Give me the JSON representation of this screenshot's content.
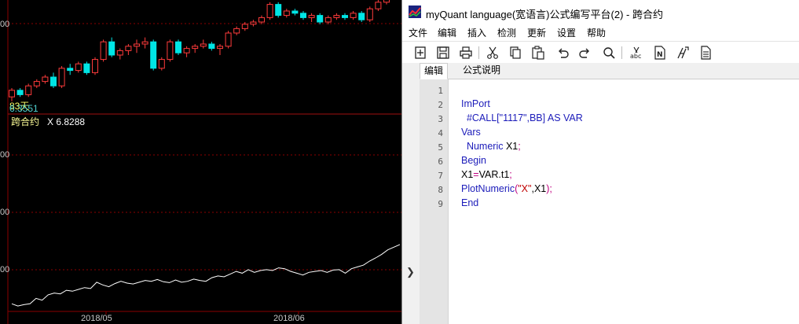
{
  "chart_pane": {
    "main_series_label": "83天",
    "main_series_value": "6.3551",
    "indicator_title": "跨合约",
    "indicator_value_label": "X 6.8288",
    "y_labels": [
      "00",
      "00",
      "00",
      "00"
    ],
    "date_labels": [
      "2018/05",
      "2018/06"
    ],
    "colors": {
      "up": "#ff3b3b",
      "down": "#00e5e5",
      "grid": "#8b0000",
      "line": "#ffffff"
    }
  },
  "editor": {
    "title": "myQuant language(宽语言)公式编写平台(2) - 跨合约",
    "menu": [
      "文件",
      "编辑",
      "插入",
      "检测",
      "更新",
      "设置",
      "帮助"
    ],
    "toolbar_icons": [
      "new-icon",
      "save-icon",
      "print-icon",
      "cut-icon",
      "copy-icon",
      "paste-icon",
      "undo-icon",
      "redo-icon",
      "find-icon",
      "spellcheck-icon",
      "document-n-icon",
      "tools-icon",
      "notes-icon"
    ],
    "tabs": [
      "编辑",
      "公式说明"
    ],
    "line_numbers": [
      "1",
      "2",
      "3",
      "4",
      "5",
      "6",
      "7",
      "8",
      "9"
    ],
    "code": {
      "l2": "ImPort",
      "l3": "  #CALL[\"1117\",BB] AS VAR",
      "l4": "Vars",
      "l5_kw": "  Numeric ",
      "l5_rest": "X1",
      "l5_p": ";",
      "l6": "Begin",
      "l7_a": "X1",
      "l7_eq": "=",
      "l7_b": "VAR.t1",
      "l7_p": ";",
      "l8_kw": "PlotNumeric",
      "l8_p1": "(",
      "l8_str": "\"X\"",
      "l8_c": ",X1",
      "l8_p2": ");",
      "l9": "End"
    }
  },
  "chart_data": [
    {
      "type": "candlestick",
      "title": "",
      "x_labels": [
        "2018/05",
        "2018/06"
      ],
      "candles": [
        [
          5.6,
          5.8,
          5.5,
          5.75
        ],
        [
          5.75,
          5.8,
          5.6,
          5.65
        ],
        [
          5.65,
          5.9,
          5.6,
          5.85
        ],
        [
          5.85,
          6.0,
          5.8,
          5.95
        ],
        [
          5.95,
          6.1,
          5.9,
          6.05
        ],
        [
          6.05,
          6.15,
          5.8,
          5.85
        ],
        [
          5.85,
          6.3,
          5.8,
          6.25
        ],
        [
          6.25,
          6.35,
          6.1,
          6.2
        ],
        [
          6.2,
          6.4,
          6.15,
          6.35
        ],
        [
          6.35,
          6.4,
          6.1,
          6.15
        ],
        [
          6.15,
          6.5,
          6.1,
          6.45
        ],
        [
          6.45,
          6.9,
          6.4,
          6.85
        ],
        [
          6.85,
          6.95,
          6.5,
          6.55
        ],
        [
          6.55,
          6.7,
          6.45,
          6.65
        ],
        [
          6.65,
          6.8,
          6.55,
          6.75
        ],
        [
          6.75,
          6.9,
          6.6,
          6.8
        ],
        [
          6.8,
          6.95,
          6.7,
          6.85
        ],
        [
          6.85,
          6.9,
          6.2,
          6.25
        ],
        [
          6.25,
          6.5,
          6.2,
          6.45
        ],
        [
          6.45,
          6.9,
          6.4,
          6.85
        ],
        [
          6.85,
          6.9,
          6.55,
          6.6
        ],
        [
          6.6,
          6.75,
          6.5,
          6.7
        ],
        [
          6.7,
          6.8,
          6.6,
          6.75
        ],
        [
          6.75,
          6.9,
          6.7,
          6.8
        ],
        [
          6.8,
          6.85,
          6.65,
          6.7
        ],
        [
          6.7,
          6.8,
          6.55,
          6.75
        ],
        [
          6.75,
          7.1,
          6.7,
          7.05
        ],
        [
          7.05,
          7.2,
          7.0,
          7.15
        ],
        [
          7.15,
          7.3,
          7.1,
          7.25
        ],
        [
          7.25,
          7.35,
          7.2,
          7.3
        ],
        [
          7.3,
          7.45,
          7.25,
          7.4
        ],
        [
          7.4,
          7.75,
          7.35,
          7.7
        ],
        [
          7.7,
          7.75,
          7.4,
          7.45
        ],
        [
          7.45,
          7.6,
          7.4,
          7.55
        ],
        [
          7.55,
          7.6,
          7.45,
          7.5
        ],
        [
          7.5,
          7.55,
          7.35,
          7.4
        ],
        [
          7.4,
          7.5,
          7.3,
          7.45
        ],
        [
          7.45,
          7.5,
          7.25,
          7.3
        ],
        [
          7.3,
          7.45,
          7.25,
          7.4
        ],
        [
          7.4,
          7.5,
          7.35,
          7.45
        ],
        [
          7.45,
          7.5,
          7.35,
          7.4
        ],
        [
          7.4,
          7.55,
          7.35,
          7.5
        ],
        [
          7.5,
          7.55,
          7.3,
          7.35
        ],
        [
          7.35,
          7.65,
          7.3,
          7.6
        ],
        [
          7.6,
          7.8,
          7.55,
          7.75
        ],
        [
          7.75,
          7.9,
          7.7,
          7.85
        ]
      ]
    },
    {
      "type": "line",
      "title": "跨合约",
      "series": [
        {
          "name": "X",
          "values": [
            5.5,
            5.45,
            5.48,
            5.5,
            5.62,
            5.58,
            5.7,
            5.74,
            5.72,
            5.8,
            5.78,
            5.82,
            5.86,
            5.84,
            5.98,
            5.92,
            5.88,
            5.95,
            6.0,
            5.96,
            5.94,
            5.98,
            6.02,
            6.0,
            6.04,
            5.99,
            5.97,
            6.03,
            5.98,
            6.0,
            6.05,
            6.02,
            6.0,
            6.08,
            6.12,
            6.1,
            6.16,
            6.22,
            6.18,
            6.26,
            6.2,
            6.24,
            6.26,
            6.24,
            6.3,
            6.28,
            6.22,
            6.18,
            6.14,
            6.2,
            6.22,
            6.24,
            6.2,
            6.25,
            6.26,
            6.18,
            6.28,
            6.32,
            6.36,
            6.45,
            6.52,
            6.6,
            6.7,
            6.76,
            6.82
          ]
        }
      ]
    }
  ]
}
